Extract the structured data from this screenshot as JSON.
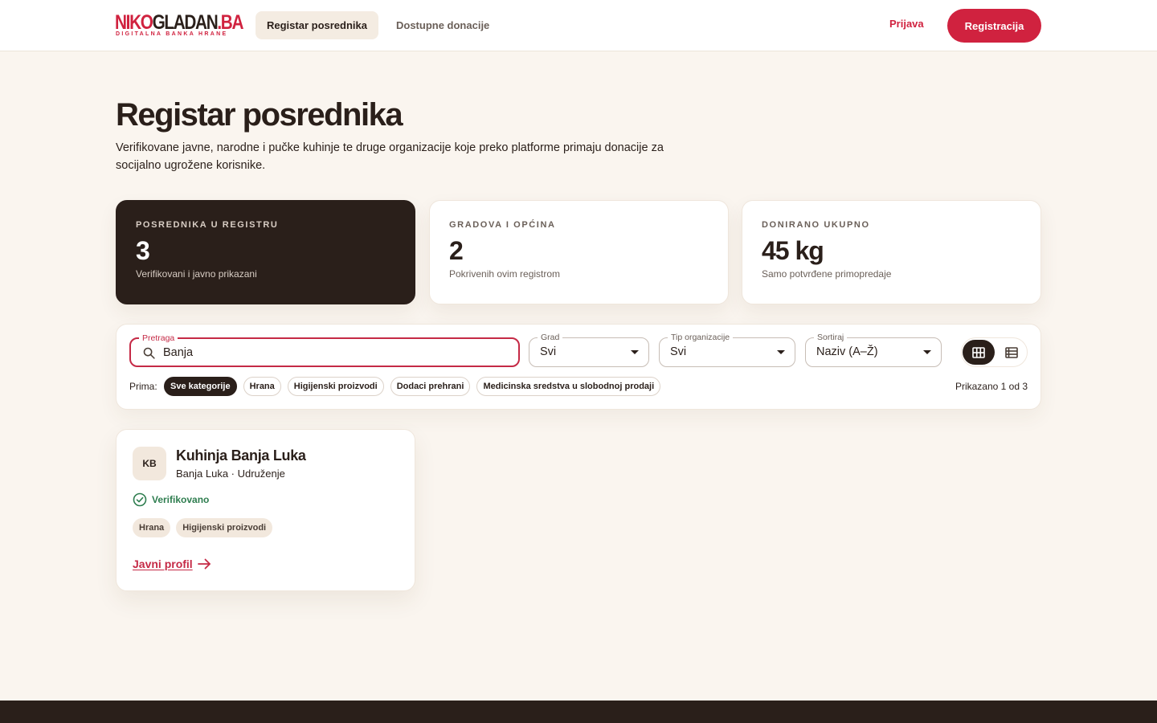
{
  "brand": {
    "logo_part1": "NIKO",
    "logo_part2": "GLADAN",
    "logo_part3": ".BA",
    "tagline": "DIGITALNA BANKA HRANE"
  },
  "nav": {
    "tabs": [
      {
        "label": "Registar posrednika",
        "active": true
      },
      {
        "label": "Dostupne donacije",
        "active": false
      }
    ],
    "login_label": "Prijava",
    "register_label": "Registracija"
  },
  "page": {
    "title": "Registar posrednika",
    "description": "Verifikovane javne, narodne i pučke kuhinje te druge organizacije koje preko platforme primaju donacije za socijalno ugrožene korisnike."
  },
  "stats": [
    {
      "label": "POSREDNIKA U REGISTRU",
      "value": "3",
      "note": "Verifikovani i javno prikazani"
    },
    {
      "label": "GRADOVA I OPĆINA",
      "value": "2",
      "note": "Pokrivenih ovim registrom"
    },
    {
      "label": "DONIRANO UKUPNO",
      "value": "45 kg",
      "note": "Samo potvrđene primopredaje"
    }
  ],
  "filters": {
    "search_label": "Pretraga",
    "search_value": "Banja",
    "city_label": "Grad",
    "city_value": "Svi",
    "org_type_label": "Tip organizacije",
    "org_type_value": "Svi",
    "sort_label": "Sortiraj",
    "sort_value": "Naziv (A–Ž)",
    "receives_label": "Prima:",
    "categories": [
      {
        "label": "Sve kategorije",
        "active": true
      },
      {
        "label": "Hrana",
        "active": false
      },
      {
        "label": "Higijenski proizvodi",
        "active": false
      },
      {
        "label": "Dodaci prehrani",
        "active": false
      },
      {
        "label": "Medicinska sredstva u slobodnoj prodaji",
        "active": false
      }
    ],
    "result_count": "Prikazano 1 od 3",
    "view_mode": "grid"
  },
  "results": [
    {
      "initials": "KB",
      "name": "Kuhinja Banja Luka",
      "subtitle": "Banja Luka · Udruženje",
      "verified_label": "Verifikovano",
      "tags": [
        "Hrana",
        "Higijenski proizvodi"
      ],
      "link_label": "Javni profil"
    }
  ],
  "colors": {
    "accent": "#d0223f",
    "dark": "#2a1f1a",
    "background": "#faf5ef",
    "verified": "#2e7d4f"
  },
  "icons": {
    "search": "search-icon",
    "caret": "chevron-down-icon",
    "grid_view": "grid-icon",
    "list_view": "list-icon",
    "verified": "check-circle-icon",
    "arrow": "arrow-right-icon"
  }
}
